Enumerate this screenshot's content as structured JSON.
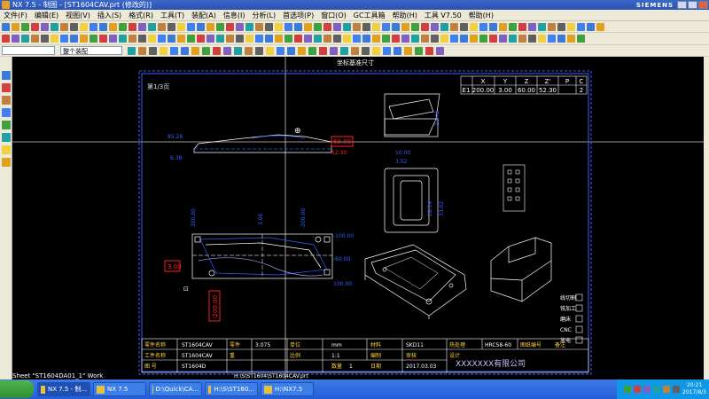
{
  "titlebar": {
    "title": "NX 7.5 - 制图 - [ST1604CAV.prt (修改的)]",
    "brand": "SIEMENS"
  },
  "menu": [
    "文件(F)",
    "编辑(E)",
    "视图(V)",
    "插入(S)",
    "格式(R)",
    "工具(T)",
    "装配(A)",
    "信息(I)",
    "分析(L)",
    "首选项(P)",
    "窗口(O)",
    "GC工具箱",
    "帮助(H)",
    "工具 V7.50",
    "帮助(H)"
  ],
  "filter": {
    "value": "",
    "type": "整个装配"
  },
  "viewport": {
    "sheet_label": "坐标基准尺寸",
    "status": "Sheet \"ST1604DA01_1\" Work"
  },
  "drawing": {
    "sheet_tag": "第1/3页",
    "top_table": {
      "headers": [
        "X",
        "Y",
        "Z",
        "Z'",
        "P",
        "C"
      ],
      "row": [
        "E1",
        "200.00",
        "3.00",
        "60.00",
        "52.30",
        "2"
      ]
    },
    "dims": [
      "85.28",
      "6.38",
      "200.00",
      "3.00",
      "52.30",
      "-60.00",
      "-52.30",
      "-200.00",
      "-100.00",
      "100.00",
      "23.42",
      "10.00",
      "3.52",
      "28.14",
      "33.02"
    ],
    "red_tags": {
      "right": "68.00",
      "left": "3.00",
      "bottom": "-200.00"
    },
    "title_block": {
      "rows": [
        [
          "零件名称",
          "ST1604CAV",
          "零件",
          "3.075",
          "单位",
          "mm",
          "材料",
          "SKD11",
          "热处理",
          "HRC58-60",
          "图纸编号",
          "",
          "备注",
          ""
        ],
        [
          "工件名称",
          "ST1604CAV",
          "重",
          "",
          "比例",
          "1:1",
          "编制",
          "",
          "审核",
          "",
          "设计",
          "",
          "",
          ""
        ],
        [
          "图 号",
          "ST1604D",
          "",
          "",
          "",
          "",
          "日期",
          "2017.03.03",
          "数量",
          "1",
          "",
          "",
          ""
        ]
      ],
      "path": "H:\\S\\ST1604\\ST1604CAV.prt",
      "company": "XXXXXXX有限公司"
    },
    "side_checks": [
      "线切割",
      "铣加工",
      "磨床",
      "CNC",
      "放电",
      "研磨"
    ]
  },
  "taskbar": {
    "items": [
      {
        "label": "NX 7.5 - 制...",
        "active": true
      },
      {
        "label": "NX 7.5",
        "active": false
      },
      {
        "label": "D:\\Quick\\CA...",
        "active": false
      },
      {
        "label": "H:\\S\\ST160...",
        "active": false
      },
      {
        "label": "H:\\NX7.5",
        "active": false
      }
    ],
    "clock": {
      "time": "20:21",
      "date": "2017/8/3"
    }
  },
  "colors": {
    "accent": "#245edc",
    "border": "#4040ff",
    "dim": "#3060ff",
    "red": "#ff2020"
  }
}
